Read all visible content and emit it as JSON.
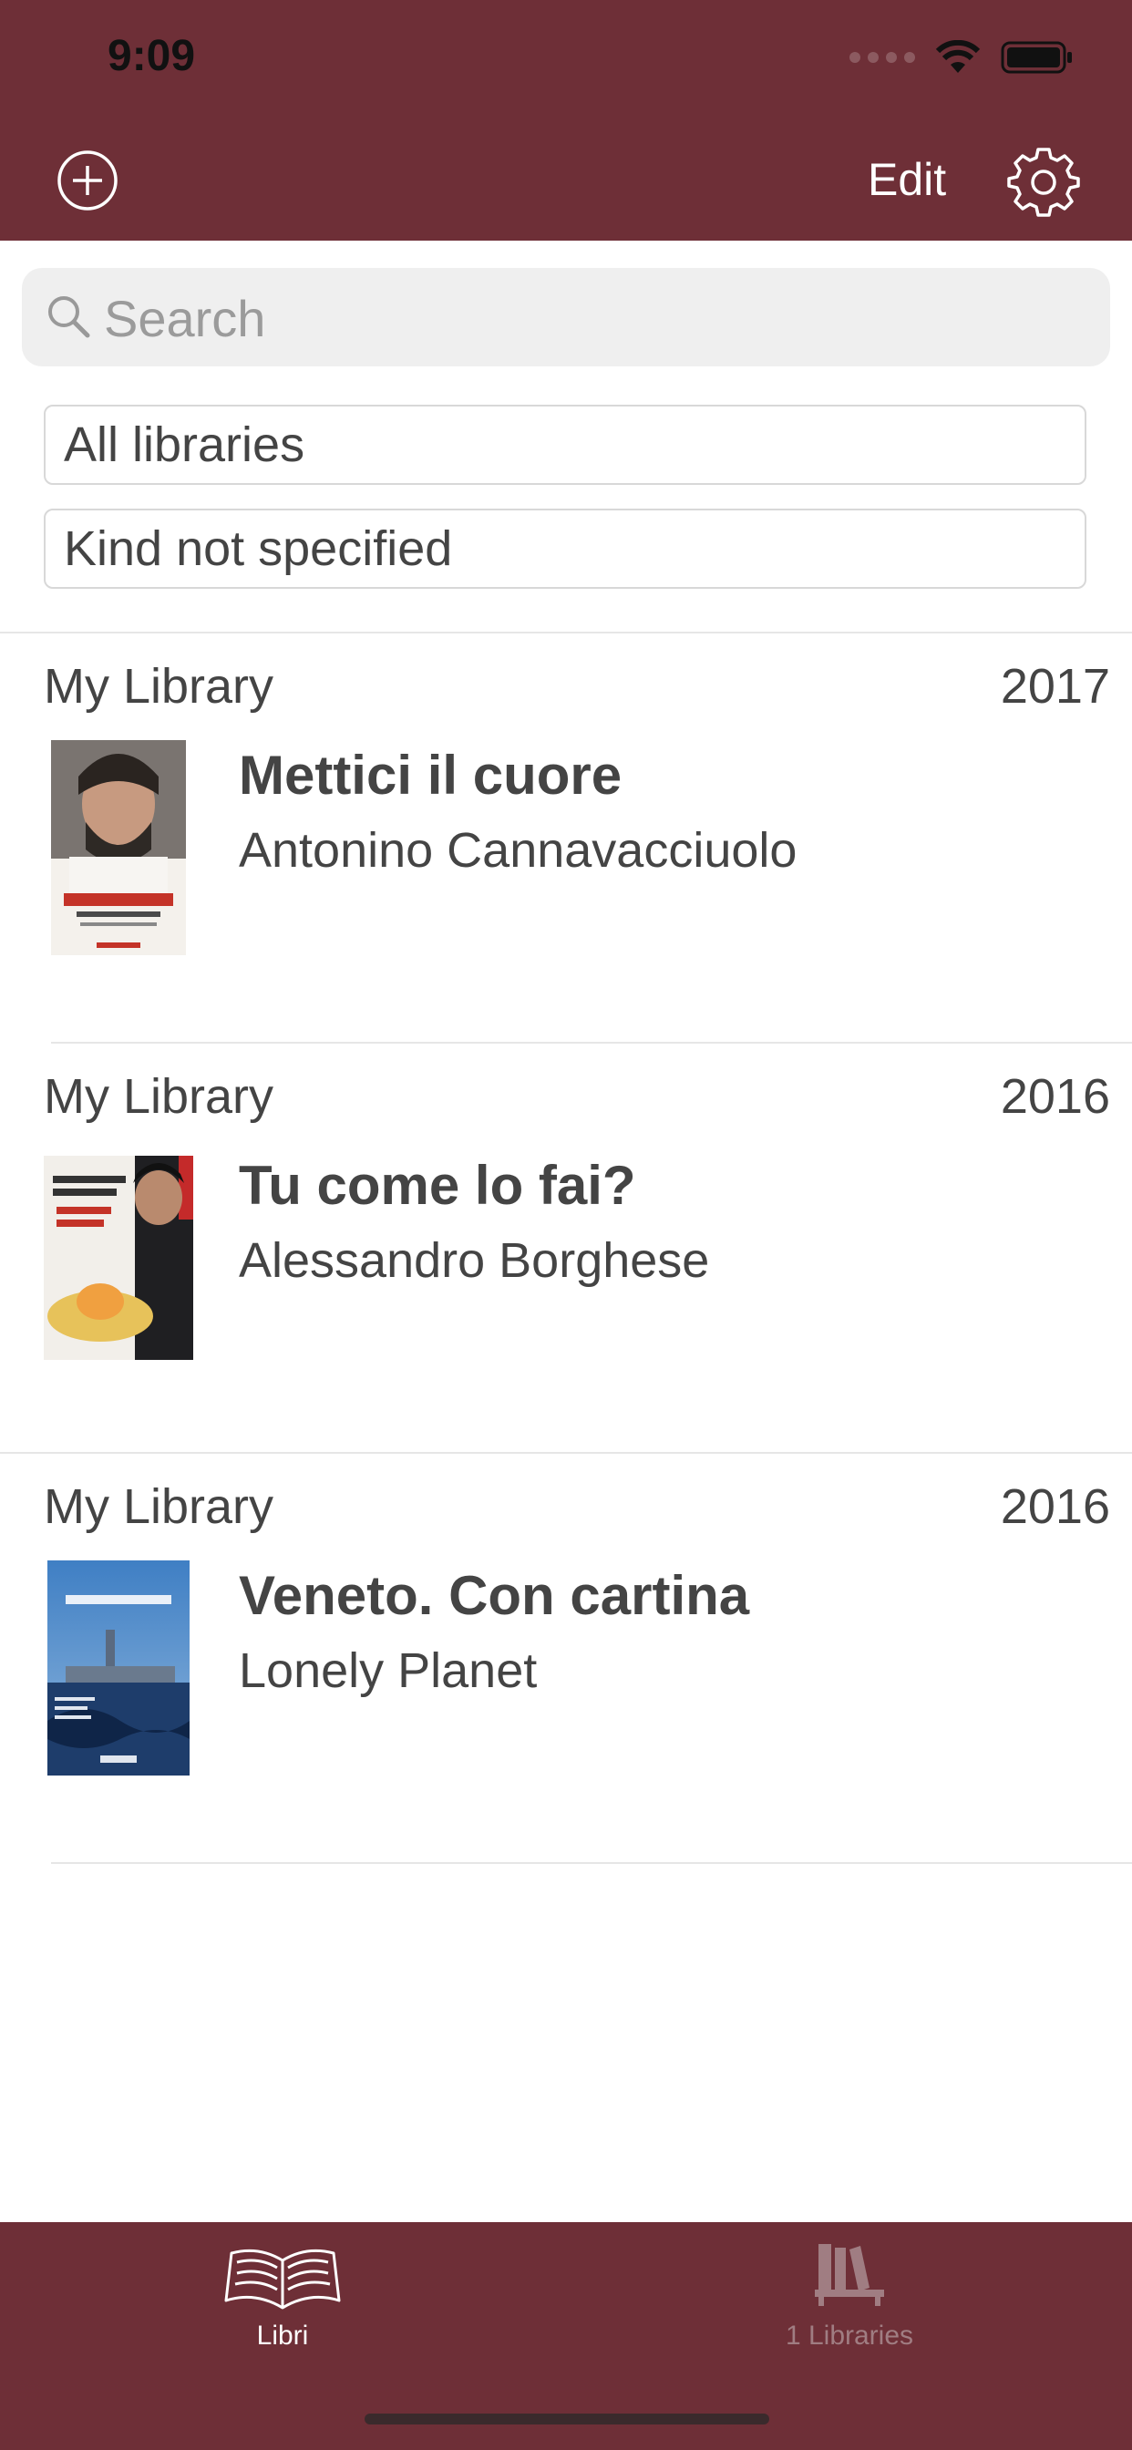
{
  "status": {
    "time": "9:09"
  },
  "nav": {
    "edit_label": "Edit"
  },
  "search": {
    "placeholder": "Search"
  },
  "filters": {
    "library": "All libraries",
    "kind": "Kind not specified"
  },
  "books": [
    {
      "library": "My Library",
      "year": "2017",
      "title": "Mettici il cuore",
      "author": "Antonino Cannavacciuolo"
    },
    {
      "library": "My Library",
      "year": "2016",
      "title": "Tu come lo fai?",
      "author": "Alessandro Borghese"
    },
    {
      "library": "My Library",
      "year": "2016",
      "title": "Veneto. Con cartina",
      "author": "Lonely Planet"
    }
  ],
  "tabs": [
    {
      "label": "Libri",
      "icon": "open-book-icon",
      "active": true
    },
    {
      "label": "1 Libraries",
      "icon": "bookshelf-icon",
      "active": false
    }
  ],
  "colors": {
    "bar": "#6e2f37",
    "tab_active": "#ffffff",
    "tab_inactive": "#a07d82"
  }
}
